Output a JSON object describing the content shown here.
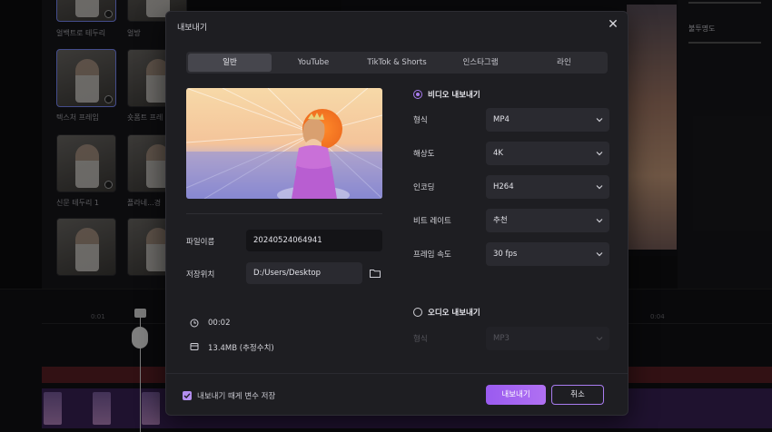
{
  "background": {
    "media_labels": [
      "얼백트로 테두리",
      "얼방",
      "텍스처 프레임",
      "숏폼트 프레",
      "신문 테두리 1",
      "플라네...경"
    ],
    "property_label": "불투명도",
    "timeline_ticks": [
      "0:01",
      "0:04"
    ]
  },
  "dialog": {
    "title": "내보내기",
    "tabs": [
      "일반",
      "YouTube",
      "TikTok & Shorts",
      "인스타그램",
      "라인"
    ],
    "active_tab": "일반",
    "file_name_label": "파일이름",
    "file_name_value": "20240524064941",
    "save_path_label": "저장위치",
    "save_path_value": "D:/Users/Desktop",
    "duration": "00:02",
    "file_size": "13.4MB (추정수치)",
    "video_export_label": "비디오 내보내기",
    "video_export_selected": true,
    "options": [
      {
        "label": "형식",
        "value": "MP4"
      },
      {
        "label": "해상도",
        "value": "4K"
      },
      {
        "label": "인코딩",
        "value": "H264"
      },
      {
        "label": "비트 레이트",
        "value": "추천"
      },
      {
        "label": "프레임 속도",
        "value": "30  fps"
      }
    ],
    "audio_export_label": "오디오 내보내기",
    "audio_export_selected": false,
    "audio_format_label": "형식",
    "audio_format_value": "MP3",
    "remember_label": "내보내기 때게 변수 저장",
    "remember_checked": true,
    "export_button": "내보내기",
    "cancel_button": "취소"
  },
  "colors": {
    "accent": "#a97cf0",
    "modal_bg": "#1e1e22",
    "field_bg": "#2a2a30"
  }
}
